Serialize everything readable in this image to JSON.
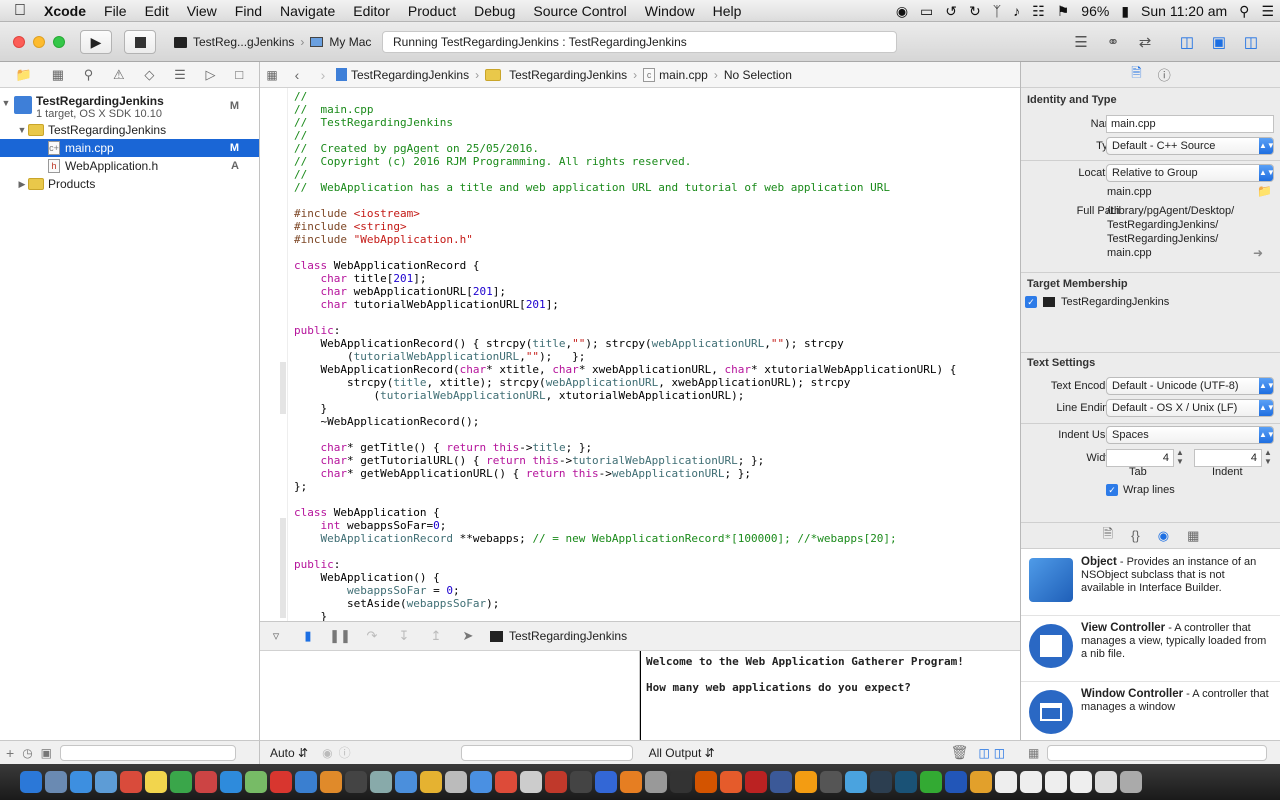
{
  "menubar": {
    "apple_icon": "apple-icon",
    "app_name": "Xcode",
    "items": [
      "File",
      "Edit",
      "View",
      "Find",
      "Navigate",
      "Editor",
      "Product",
      "Debug",
      "Source Control",
      "Window",
      "Help"
    ],
    "battery": "96%",
    "clock": "Sun 11:20 am"
  },
  "toolbar": {
    "scheme_name": "TestReg...gJenkins",
    "destination": "My Mac",
    "activity_status": "Running TestRegardingJenkins : TestRegardingJenkins"
  },
  "navigator": {
    "project": {
      "name": "TestRegardingJenkins",
      "subtitle": "1 target, OS X SDK 10.10",
      "badge": "M"
    },
    "group": {
      "name": "TestRegardingJenkins"
    },
    "files": [
      {
        "name": "main.cpp",
        "badge": "M",
        "selected": true
      },
      {
        "name": "WebApplication.h",
        "badge": "A",
        "selected": false
      }
    ],
    "products": {
      "name": "Products"
    }
  },
  "jumpbar": {
    "crumbs": [
      "TestRegardingJenkins",
      "TestRegardingJenkins",
      "main.cpp",
      "No Selection"
    ]
  },
  "editor": {
    "lines": [
      [
        [
          "c-com",
          "//"
        ]
      ],
      [
        [
          "c-com",
          "//  main.cpp"
        ]
      ],
      [
        [
          "c-com",
          "//  TestRegardingJenkins"
        ]
      ],
      [
        [
          "c-com",
          "//"
        ]
      ],
      [
        [
          "c-com",
          "//  Created by pgAgent on 25/05/2016."
        ]
      ],
      [
        [
          "c-com",
          "//  Copyright (c) 2016 RJM Programming. All rights reserved."
        ]
      ],
      [
        [
          "c-com",
          "//"
        ]
      ],
      [
        [
          "c-com",
          "//  WebApplication has a title and web application URL and tutorial of web application URL"
        ]
      ],
      [
        [
          "",
          ""
        ]
      ],
      [
        [
          "c-pp",
          "#include "
        ],
        [
          "c-inc",
          "<iostream>"
        ]
      ],
      [
        [
          "c-pp",
          "#include "
        ],
        [
          "c-inc",
          "<string>"
        ]
      ],
      [
        [
          "c-pp",
          "#include "
        ],
        [
          "c-inc",
          "\"WebApplication.h\""
        ]
      ],
      [
        [
          "",
          ""
        ]
      ],
      [
        [
          "c-kw",
          "class"
        ],
        [
          "",
          " WebApplicationRecord {"
        ]
      ],
      [
        [
          "",
          "    "
        ],
        [
          "c-kw",
          "char"
        ],
        [
          "",
          " title["
        ],
        [
          "c-num",
          "201"
        ],
        [
          "",
          "];"
        ]
      ],
      [
        [
          "",
          "    "
        ],
        [
          "c-kw",
          "char"
        ],
        [
          "",
          " webApplicationURL["
        ],
        [
          "c-num",
          "201"
        ],
        [
          "",
          "];"
        ]
      ],
      [
        [
          "",
          "    "
        ],
        [
          "c-kw",
          "char"
        ],
        [
          "",
          " tutorialWebApplicationURL["
        ],
        [
          "c-num",
          "201"
        ],
        [
          "",
          "];"
        ]
      ],
      [
        [
          "",
          ""
        ]
      ],
      [
        [
          "c-kw",
          "public"
        ],
        [
          "",
          ":"
        ]
      ],
      [
        [
          "",
          "    WebApplicationRecord() { strcpy("
        ],
        [
          "c-mem",
          "title"
        ],
        [
          "",
          ","
        ],
        [
          "c-str",
          "\"\""
        ],
        [
          "",
          "); strcpy("
        ],
        [
          "c-mem",
          "webApplicationURL"
        ],
        [
          "",
          ","
        ],
        [
          "c-str",
          "\"\""
        ],
        [
          "",
          "); strcpy"
        ]
      ],
      [
        [
          "",
          "        ("
        ],
        [
          "c-mem",
          "tutorialWebApplicationURL"
        ],
        [
          "",
          ","
        ],
        [
          "c-str",
          "\"\""
        ],
        [
          "",
          ");   };"
        ]
      ],
      [
        [
          "",
          "    WebApplicationRecord("
        ],
        [
          "c-kw",
          "char"
        ],
        [
          "",
          "* xtitle, "
        ],
        [
          "c-kw",
          "char"
        ],
        [
          "",
          "* xwebApplicationURL, "
        ],
        [
          "c-kw",
          "char"
        ],
        [
          "",
          "* xtutorialWebApplicationURL) {"
        ]
      ],
      [
        [
          "",
          "        strcpy("
        ],
        [
          "c-mem",
          "title"
        ],
        [
          "",
          ", xtitle); strcpy("
        ],
        [
          "c-mem",
          "webApplicationURL"
        ],
        [
          "",
          ", xwebApplicationURL); strcpy"
        ]
      ],
      [
        [
          "",
          "            ("
        ],
        [
          "c-mem",
          "tutorialWebApplicationURL"
        ],
        [
          "",
          ", xtutorialWebApplicationURL);"
        ]
      ],
      [
        [
          "",
          "    }"
        ]
      ],
      [
        [
          "",
          "    ~WebApplicationRecord();"
        ]
      ],
      [
        [
          "",
          ""
        ]
      ],
      [
        [
          "",
          "    "
        ],
        [
          "c-kw",
          "char"
        ],
        [
          "",
          "* getTitle() { "
        ],
        [
          "c-kw",
          "return this"
        ],
        [
          "",
          "->"
        ],
        [
          "c-mem",
          "title"
        ],
        [
          "",
          "; };"
        ]
      ],
      [
        [
          "",
          "    "
        ],
        [
          "c-kw",
          "char"
        ],
        [
          "",
          "* getTutorialURL() { "
        ],
        [
          "c-kw",
          "return this"
        ],
        [
          "",
          "->"
        ],
        [
          "c-mem",
          "tutorialWebApplicationURL"
        ],
        [
          "",
          "; };"
        ]
      ],
      [
        [
          "",
          "    "
        ],
        [
          "c-kw",
          "char"
        ],
        [
          "",
          "* getWebApplicationURL() { "
        ],
        [
          "c-kw",
          "return this"
        ],
        [
          "",
          "->"
        ],
        [
          "c-mem",
          "webApplicationURL"
        ],
        [
          "",
          "; };"
        ]
      ],
      [
        [
          "",
          "};"
        ]
      ],
      [
        [
          "",
          ""
        ]
      ],
      [
        [
          "c-kw",
          "class"
        ],
        [
          "",
          " WebApplication {"
        ]
      ],
      [
        [
          "",
          "    "
        ],
        [
          "c-kw",
          "int"
        ],
        [
          "",
          " webappsSoFar="
        ],
        [
          "c-num",
          "0"
        ],
        [
          "",
          ";"
        ]
      ],
      [
        [
          "",
          "    "
        ],
        [
          "c-mem",
          "WebApplicationRecord"
        ],
        [
          "",
          " **webapps; "
        ],
        [
          "c-com",
          "// = new WebApplicationRecord*[100000]; //*webapps[20];"
        ]
      ],
      [
        [
          "",
          ""
        ]
      ],
      [
        [
          "c-kw",
          "public"
        ],
        [
          "",
          ":"
        ]
      ],
      [
        [
          "",
          "    WebApplication() {"
        ]
      ],
      [
        [
          "",
          "        "
        ],
        [
          "c-mem",
          "webappsSoFar"
        ],
        [
          "",
          " = "
        ],
        [
          "c-num",
          "0"
        ],
        [
          "",
          ";"
        ]
      ],
      [
        [
          "",
          "        setAside("
        ],
        [
          "c-mem",
          "webappsSoFar"
        ],
        [
          "",
          ");"
        ]
      ],
      [
        [
          "",
          "    }"
        ]
      ]
    ]
  },
  "debug": {
    "target_name": "TestRegardingJenkins",
    "console_lines": [
      "Welcome to the Web Application Gatherer Program!",
      "",
      "How many web applications do you expect?"
    ],
    "vars_mode": "Auto",
    "output_mode": "All Output"
  },
  "inspector": {
    "identity_heading": "Identity and Type",
    "name_label": "Name",
    "name_value": "main.cpp",
    "type_label": "Type",
    "type_value": "Default - C++ Source",
    "location_label": "Location",
    "location_value": "Relative to Group",
    "location_file": "main.cpp",
    "fullpath_label": "Full Path",
    "fullpath_lines": [
      "/Library/pgAgent/Desktop/",
      "TestRegardingJenkins/",
      "TestRegardingJenkins/",
      "main.cpp"
    ],
    "target_heading": "Target Membership",
    "target_name": "TestRegardingJenkins",
    "text_heading": "Text Settings",
    "encoding_label": "Text Encoding",
    "encoding_value": "Default - Unicode (UTF-8)",
    "endings_label": "Line Endings",
    "endings_value": "Default - OS X / Unix (LF)",
    "indent_label": "Indent Using",
    "indent_value": "Spaces",
    "widths_label": "Widths",
    "tab_width": "4",
    "indent_width": "4",
    "tab_caption": "Tab",
    "indent_caption": "Indent",
    "wrap_label": "Wrap lines"
  },
  "library": {
    "items": [
      {
        "title": "Object",
        "desc": " - Provides an instance of an NSObject subclass that is not available in Interface Builder."
      },
      {
        "title": "View Controller",
        "desc": " - A controller that manages a view, typically loaded from a nib file."
      },
      {
        "title": "Window Controller",
        "desc": " - A controller that manages a window"
      }
    ]
  },
  "colors": {
    "accent": "#1a66d6",
    "comment": "#1a8a1a",
    "keyword": "#b5139b",
    "string": "#c41a16"
  }
}
